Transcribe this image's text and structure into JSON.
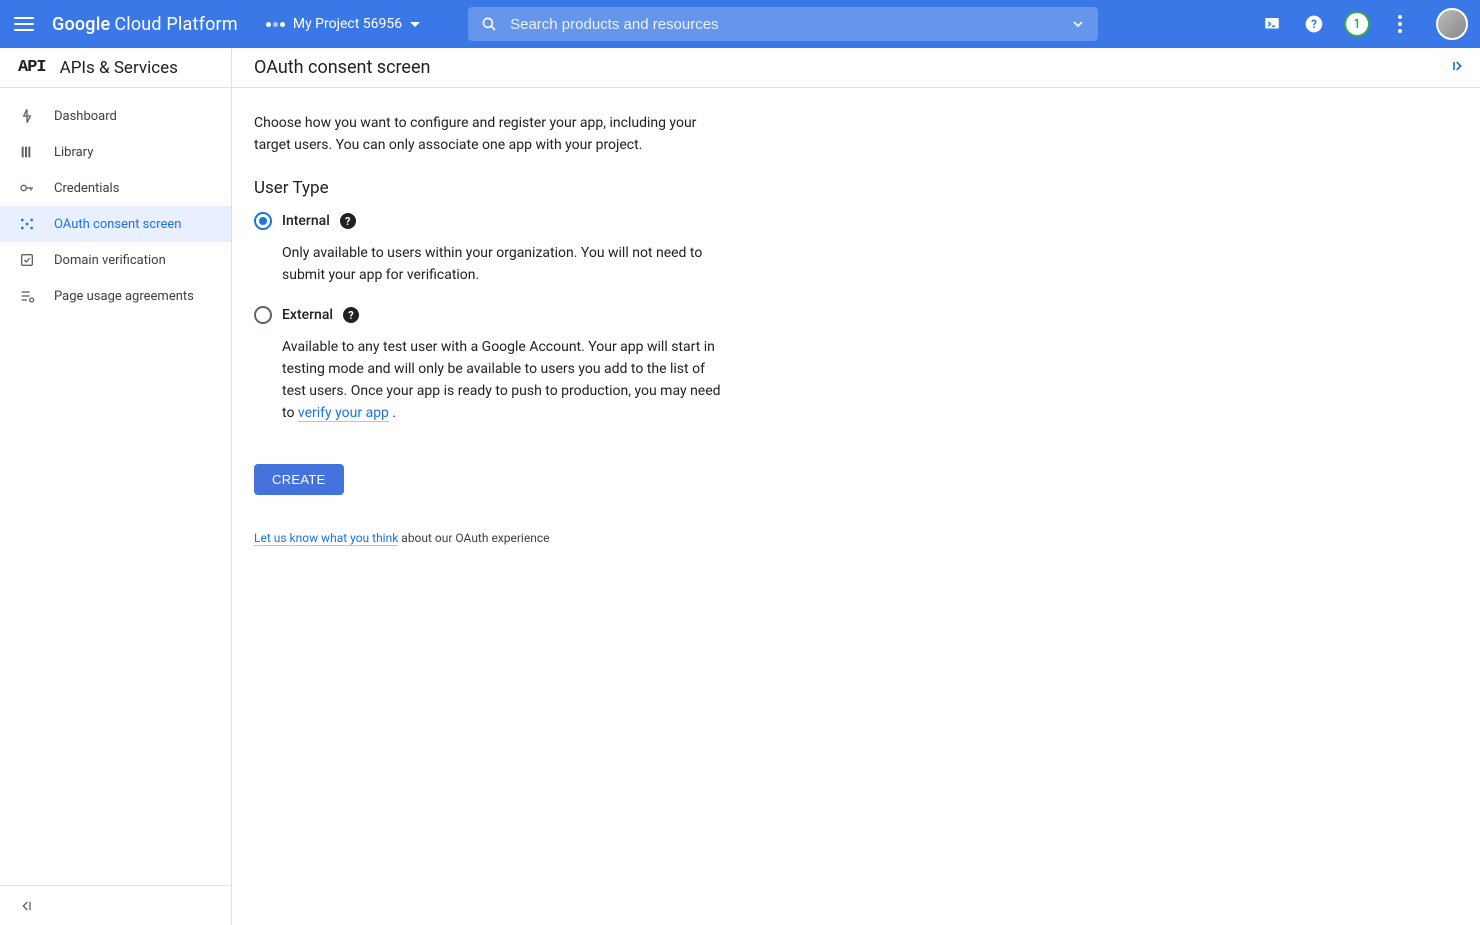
{
  "header": {
    "brand_bold": "Google",
    "brand_rest": "Cloud Platform",
    "project_name": "My Project 56956",
    "search_placeholder": "Search products and resources",
    "notification_count": "1"
  },
  "sidebar": {
    "title": "APIs & Services",
    "items": [
      {
        "label": "Dashboard"
      },
      {
        "label": "Library"
      },
      {
        "label": "Credentials"
      },
      {
        "label": "OAuth consent screen"
      },
      {
        "label": "Domain verification"
      },
      {
        "label": "Page usage agreements"
      }
    ]
  },
  "main": {
    "title": "OAuth consent screen",
    "intro": "Choose how you want to configure and register your app, including your target users. You can only associate one app with your project.",
    "section_title": "User Type",
    "options": [
      {
        "label": "Internal",
        "description": "Only available to users within your organization. You will not need to submit your app for verification."
      },
      {
        "label": "External",
        "description_pre": "Available to any test user with a Google Account. Your app will start in testing mode and will only be available to users you add to the list of test users. Once your app is ready to push to production, you may need to ",
        "link_text": "verify your app",
        "description_post": " ."
      }
    ],
    "create_label": "CREATE",
    "feedback_link": "Let us know what you think",
    "feedback_rest": " about our OAuth experience"
  }
}
